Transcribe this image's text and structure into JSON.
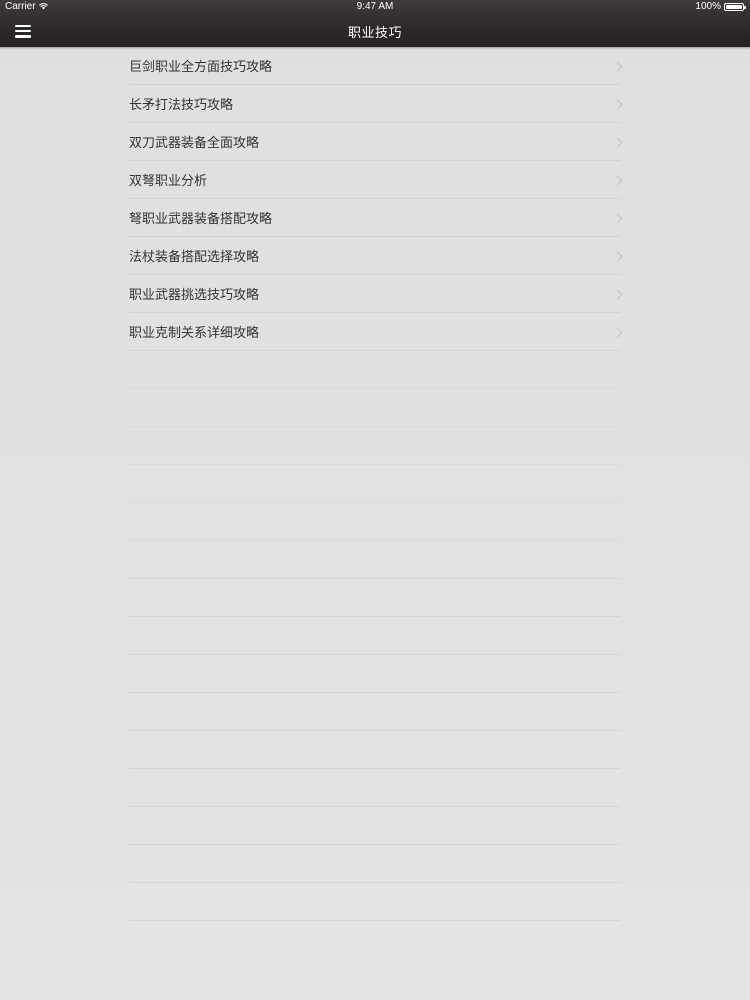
{
  "status_bar": {
    "carrier": "Carrier",
    "time": "9:47 AM",
    "battery": "100%"
  },
  "nav": {
    "title": "职业技巧",
    "menu_icon": "hamburger-menu-icon"
  },
  "list": {
    "items": [
      {
        "label": "巨剑职业全方面技巧攻略"
      },
      {
        "label": "长矛打法技巧攻略"
      },
      {
        "label": "双刀武器装备全面攻略"
      },
      {
        "label": "双弩职业分析"
      },
      {
        "label": "弩职业武器装备搭配攻略"
      },
      {
        "label": "法杖装备搭配选择攻略"
      },
      {
        "label": "职业武器挑选技巧攻略"
      },
      {
        "label": "职业克制关系详细攻略"
      }
    ],
    "chevron_icon": "chevron-right-icon"
  },
  "colors": {
    "nav_background": "#2e2b2a",
    "page_background": "#e3e1e0",
    "text": "#333333",
    "separator": "#d6d4d3"
  }
}
